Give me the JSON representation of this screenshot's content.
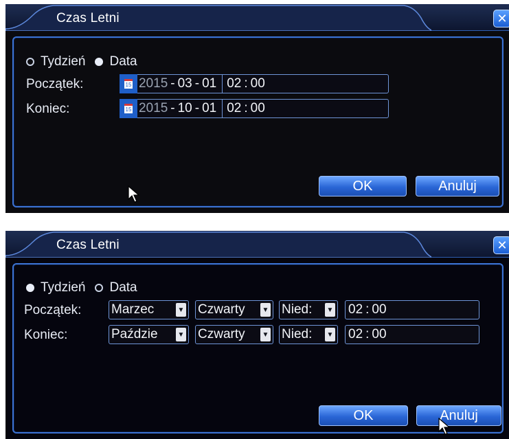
{
  "screenshots": [
    {
      "title": "Czas Letni",
      "close_glyph": "✕",
      "mode_options": [
        {
          "label": "Tydzień",
          "selected": false
        },
        {
          "label": "Data",
          "selected": true
        }
      ],
      "start_label": "Początek:",
      "end_label": "Koniec:",
      "start": {
        "year": "2015",
        "month": "03",
        "day": "01",
        "hour": "02",
        "minute": "00"
      },
      "end": {
        "year": "2015",
        "month": "10",
        "day": "01",
        "hour": "02",
        "minute": "00"
      },
      "ok_label": "OK",
      "cancel_label": "Anuluj",
      "icons": {
        "calendar": "calendar-icon",
        "cursor": "mouse-cursor-icon"
      }
    },
    {
      "title": "Czas Letni",
      "close_glyph": "✕",
      "mode_options": [
        {
          "label": "Tydzień",
          "selected": true
        },
        {
          "label": "Data",
          "selected": false
        }
      ],
      "start_label": "Początek:",
      "end_label": "Koniec:",
      "start": {
        "month": "Marzec",
        "week": "Czwarty",
        "weekday": "Nied:",
        "hour": "02",
        "minute": "00"
      },
      "end": {
        "month": "Paździe",
        "week": "Czwarty",
        "weekday": "Nied:",
        "hour": "02",
        "minute": "00"
      },
      "ok_label": "OK",
      "cancel_label": "Anuluj",
      "icons": {
        "dropdown": "chevron-down-icon",
        "cursor": "mouse-cursor-icon"
      }
    }
  ],
  "colors": {
    "accent": "#3c73d4",
    "button": "#2a66d6",
    "background": "#0b0b0f",
    "text": "#e8ecf5"
  }
}
